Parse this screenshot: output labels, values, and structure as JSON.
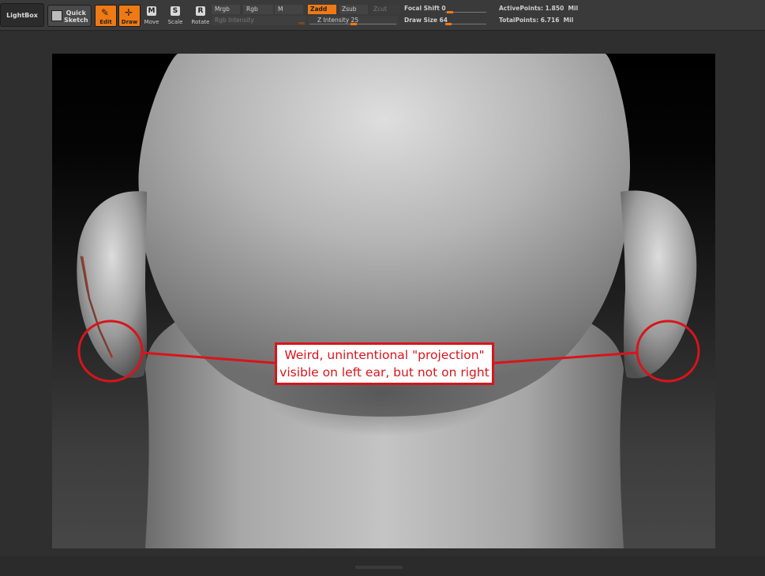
{
  "toolbar": {
    "lightbox": "LightBox",
    "quick_sketch": [
      "Quick",
      "Sketch"
    ],
    "edit": "Edit",
    "draw": "Draw",
    "move": "Move",
    "scale": "Scale",
    "rotate": "Rotate",
    "move_glyph": "M",
    "scale_glyph": "S",
    "rotate_glyph": "R",
    "mrgb": "Mrgb",
    "rgb": "Rgb",
    "m": "M",
    "rgb_intensity": "Rgb Intensity",
    "zadd": "Zadd",
    "zsub": "Zsub",
    "zcut": "Zcut",
    "z_intensity": "Z Intensity 25",
    "focal_shift": "Focal Shift 0",
    "draw_size": "Draw Size 64",
    "active_points": "ActivePoints: 1.850  Mil",
    "total_points": "TotalPoints: 6.716  Mil"
  },
  "annotation": {
    "lines": [
      "Weird, unintentional \"projection\"",
      "visible on left ear, but not on right"
    ]
  },
  "colors": {
    "accent": "#ef7a14",
    "annotation_red": "#d9141b"
  },
  "icons": {
    "edit": "edit-icon",
    "draw": "draw-crosshair-icon"
  }
}
